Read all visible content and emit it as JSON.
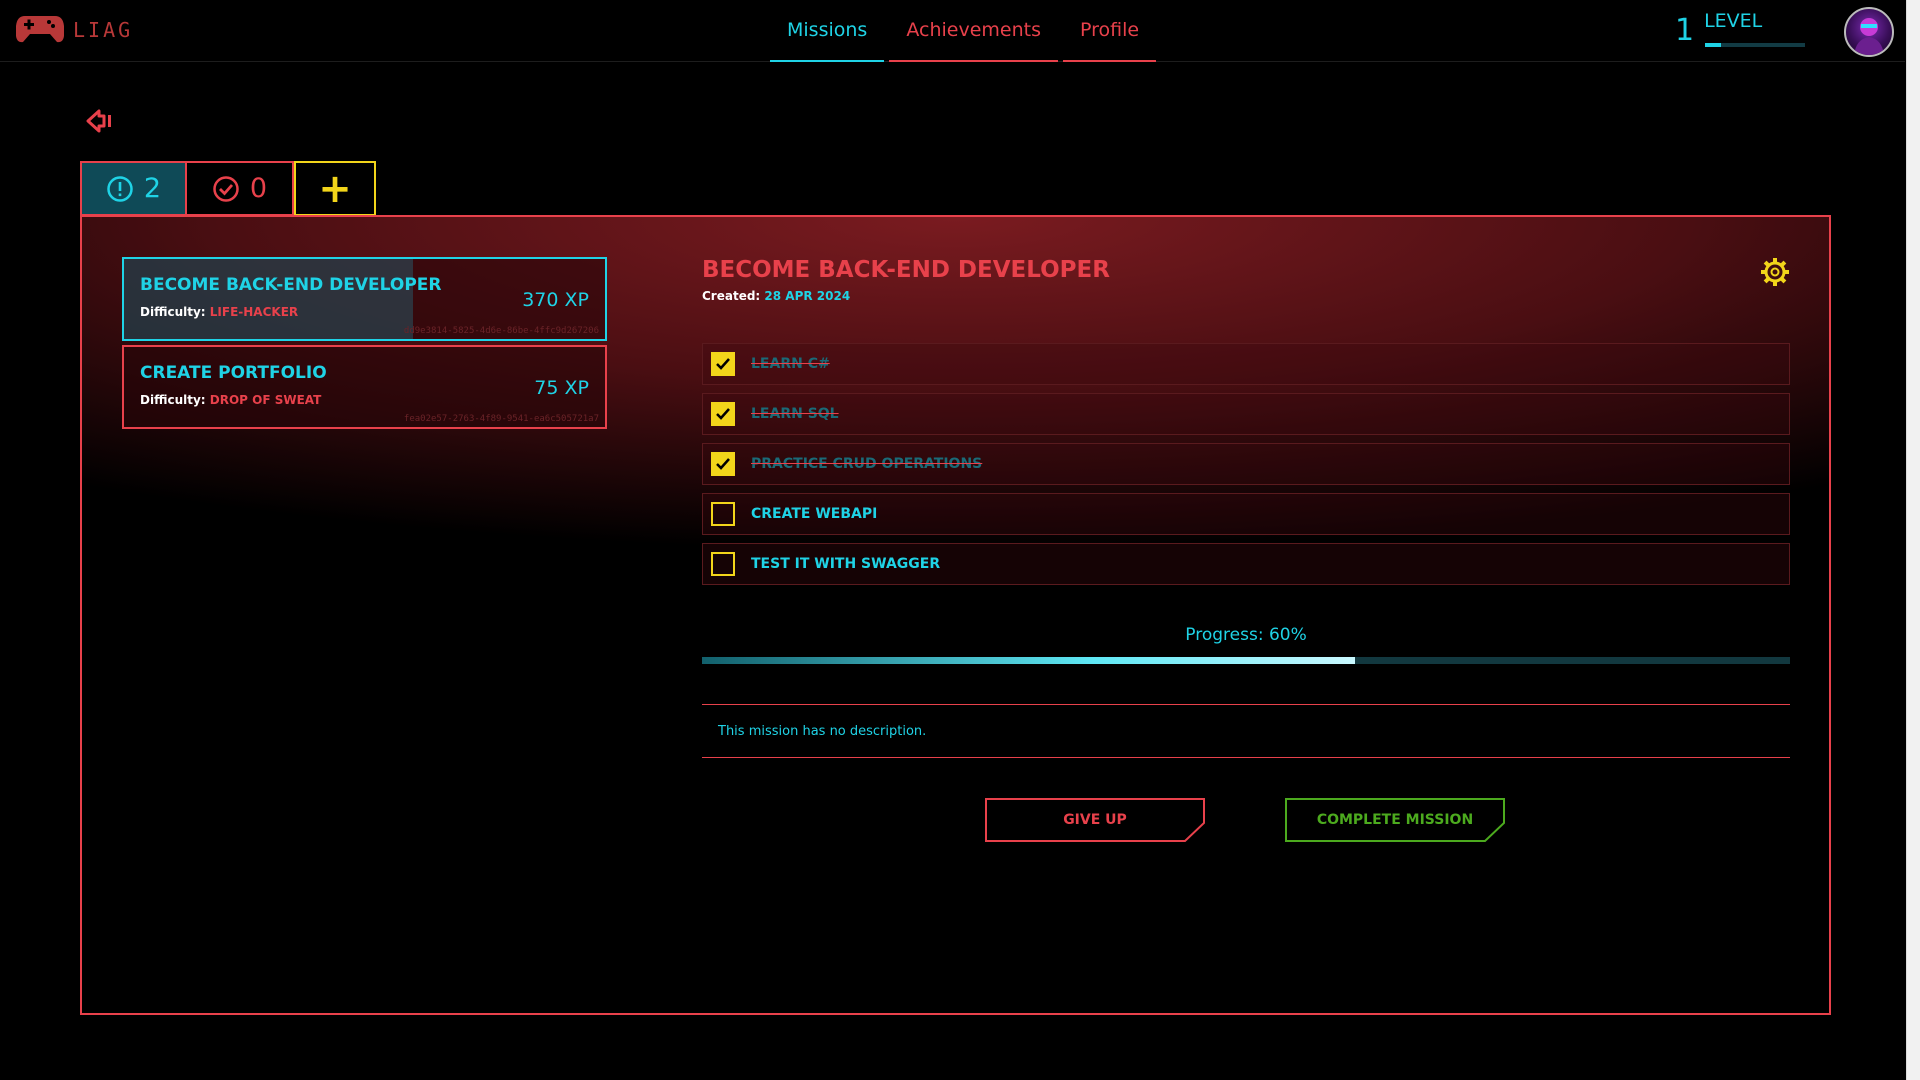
{
  "header": {
    "logo_text": "LIAG",
    "nav": [
      "Missions",
      "Achievements",
      "Profile"
    ],
    "level_number": "1",
    "level_label": "LEVEL",
    "level_progress": 0.16
  },
  "tabs": {
    "active_count": "2",
    "done_count": "0",
    "add_label": "+"
  },
  "missions": [
    {
      "title": "BECOME BACK-END DEVELOPER",
      "difficulty_label": "Difficulty:",
      "difficulty": "LIFE-HACKER",
      "xp": "370 XP",
      "id": "dd9e3814-5825-4d6e-86be-4ffc9d267206",
      "progress": 0.6
    },
    {
      "title": "CREATE PORTFOLIO",
      "difficulty_label": "Difficulty:",
      "difficulty": "DROP OF SWEAT",
      "xp": "75 XP",
      "id": "fea02e57-2763-4f89-9541-ea6c505721a7",
      "progress": 0
    }
  ],
  "detail": {
    "title": "BECOME BACK-END DEVELOPER",
    "created_label": "Created:",
    "created_date": "28 APR 2024",
    "tasks": [
      {
        "label": "LEARN C#",
        "done": true
      },
      {
        "label": "LEARN SQL",
        "done": true
      },
      {
        "label": "PRACTICE CRUD OPERATIONS",
        "done": true
      },
      {
        "label": "CREATE WEBAPI",
        "done": false
      },
      {
        "label": "TEST IT WITH SWAGGER",
        "done": false
      }
    ],
    "progress_text": "Progress: 60%",
    "progress": 0.6,
    "description": "This mission has no description.",
    "give_up_label": "GIVE UP",
    "complete_label": "COMPLETE MISSION"
  },
  "colors": {
    "accent_cyan": "#1fd3e6",
    "accent_red": "#e8414b",
    "accent_yellow": "#f2d51a",
    "accent_green": "#4caa1e"
  }
}
